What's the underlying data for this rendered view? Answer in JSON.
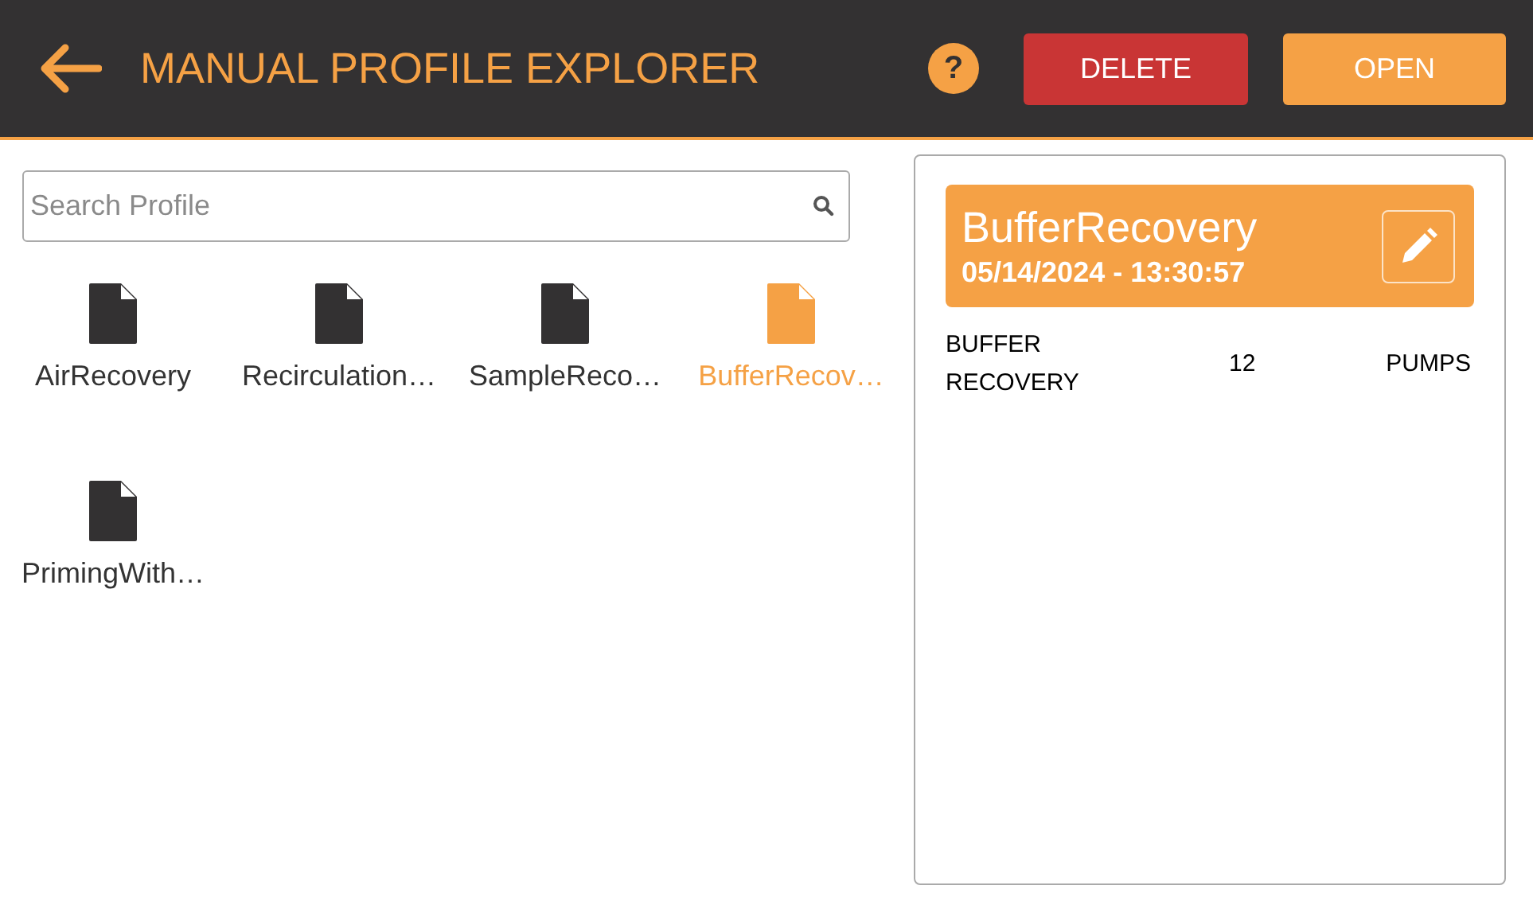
{
  "header": {
    "title": "MANUAL PROFILE EXPLORER",
    "help": "?",
    "buttons": [
      {
        "label": "DELETE",
        "kind": "danger"
      },
      {
        "label": "OPEN",
        "kind": "primary"
      }
    ]
  },
  "search": {
    "placeholder": "Search Profile"
  },
  "files": [
    {
      "name": "AirRecovery",
      "selected": false
    },
    {
      "name": "Recirculation…",
      "selected": false
    },
    {
      "name": "SampleReco…",
      "selected": false
    },
    {
      "name": "BufferRecov…",
      "selected": true
    },
    {
      "name": "PrimingWith…",
      "selected": false
    }
  ],
  "details": {
    "name": "BufferRecovery",
    "timestamp": "05/14/2024 - 13:30:57",
    "row": {
      "description": "BUFFER RECOVERY",
      "count": "12",
      "category": "PUMPS"
    }
  }
}
